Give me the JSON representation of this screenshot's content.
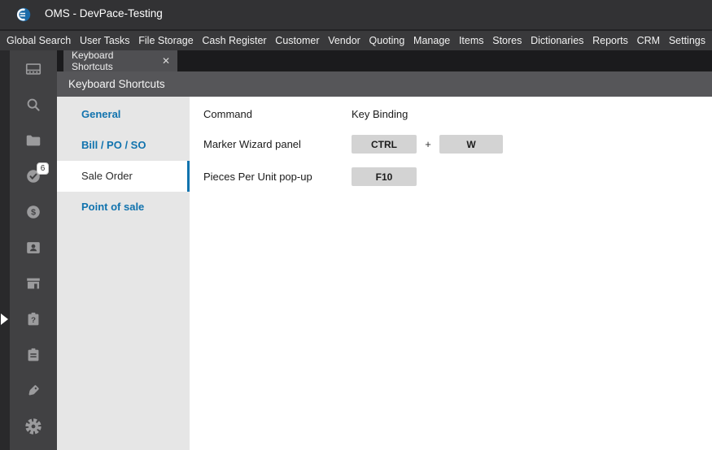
{
  "window": {
    "title": "OMS - DevPace-Testing"
  },
  "menubar": {
    "items": [
      "Global Search",
      "User Tasks",
      "File Storage",
      "Cash Register",
      "Customer",
      "Vendor",
      "Quoting",
      "Manage",
      "Items",
      "Stores",
      "Dictionaries",
      "Reports",
      "CRM",
      "Settings"
    ]
  },
  "tabs": {
    "active": {
      "label": "Keyboard Shortcuts",
      "close_glyph": "✕"
    }
  },
  "page": {
    "title": "Keyboard Shortcuts"
  },
  "sidebar": {
    "icons": [
      "dashboard-icon",
      "search-icon",
      "folder-icon",
      "tasks-check-icon",
      "dollar-icon",
      "contact-icon",
      "store-icon",
      "clipboard-question-icon",
      "clipboard-icon",
      "tag-icon",
      "gear-icon"
    ],
    "tasks_badge_count": "6"
  },
  "nav": {
    "items": [
      {
        "label": "General",
        "selected": false
      },
      {
        "label": "Bill / PO / SO",
        "selected": false
      },
      {
        "label": "Sale Order",
        "selected": true
      },
      {
        "label": "Point of sale",
        "selected": false
      }
    ]
  },
  "shortcuts": {
    "columns": {
      "command": "Command",
      "key_binding": "Key Binding"
    },
    "plus": "+",
    "rows": [
      {
        "command": "Marker Wizard panel",
        "keys": [
          "CTRL",
          "W"
        ]
      },
      {
        "command": "Pieces Per Unit pop-up",
        "keys": [
          "F10"
        ]
      }
    ]
  },
  "colors": {
    "accent_blue": "#1173ae",
    "titlebar_bg": "#323234",
    "menubar_bg": "#39393b",
    "tabbar_bg": "#1b1b1d",
    "tab_bg": "#4f4f52",
    "page_header_bg": "#565659",
    "icon_strip_bg": "#414143",
    "left_strip_bg": "#29292b",
    "nav_bg": "#e6e6e6",
    "key_bg": "#d3d3d3",
    "logo_blue": "#1b6aa8"
  }
}
